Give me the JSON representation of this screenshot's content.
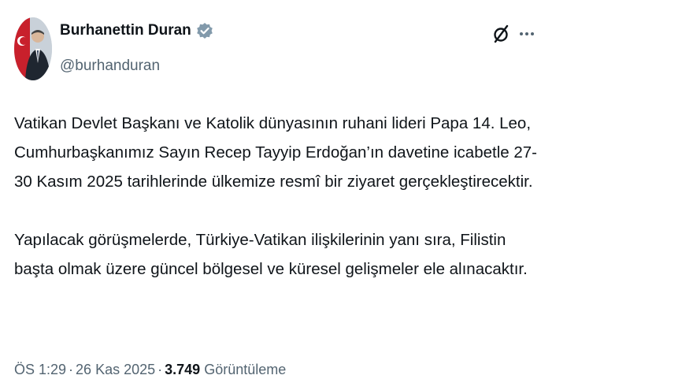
{
  "author": {
    "display_name": "Burhanettin Duran",
    "handle": "@burhanduran",
    "verified": true,
    "avatar": "avatar-photo"
  },
  "actions": {
    "grok_icon": "grok-icon",
    "more_icon": "more-dots-icon"
  },
  "tweet": {
    "paragraphs": [
      "Vatikan Devlet Başkanı ve Katolik dünyasının ruhani lideri Papa 14. Leo,\nCumhurbaşkanımız Sayın Recep Tayyip Erdoğan’ın davetine icabetle 27-\n30 Kasım 2025 tarihlerinde ülkemize resmî bir ziyaret gerçekleştirecektir.",
      "Yapılacak görüşmelerde, Türkiye-Vatikan ilişkilerinin yanı sıra, Filistin\nbaşta olmak üzere güncel bölgesel ve küresel gelişmeler ele alınacaktır."
    ]
  },
  "meta": {
    "time": "ÖS 1:29",
    "separator": "·",
    "date": "26 Kas 2025",
    "views_count": "3.749",
    "views_label": "Görüntüleme"
  },
  "colors": {
    "text": "#0f1419",
    "secondary": "#536471",
    "verified_badge": "#829aab"
  }
}
